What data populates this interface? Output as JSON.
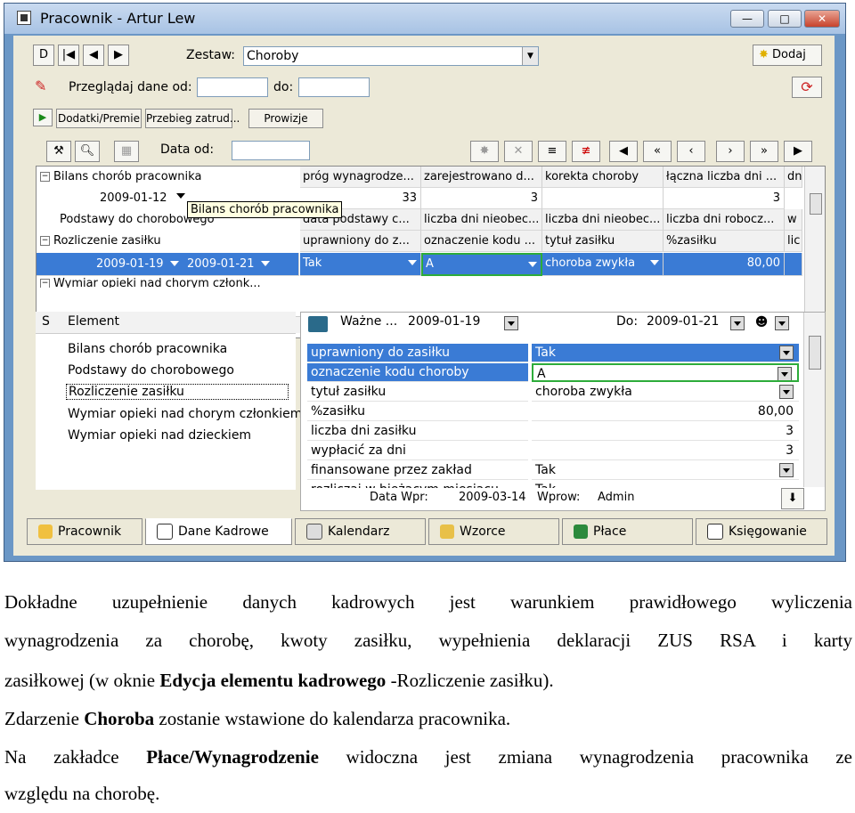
{
  "window": {
    "title": "Pracownik - Artur Lew",
    "min_label": "—",
    "max_label": "□",
    "close_label": "✕"
  },
  "toolbar1": {
    "nav": [
      "D",
      "|◀",
      "◀",
      "▶"
    ],
    "zestaw_label": "Zestaw:",
    "zestaw_value": "Choroby",
    "add_label": "Dodaj"
  },
  "toolbar2": {
    "przegladaj_label": "Przeglądaj dane od:",
    "do_label": "do:",
    "od_value": "",
    "do_value": ""
  },
  "toolbar3": {
    "buttons": [
      "Dodatki/Premie",
      "Przebieg zatrud...",
      "Prowizje"
    ]
  },
  "grid_toolbar": {
    "data_od_label": "Data od:",
    "data_od_value": ""
  },
  "tree": {
    "n1": "Bilans chorób pracownika",
    "n1_date": "2009-01-12",
    "n2": "Podstawy do chorobowego",
    "n3": "Rozliczenie zasiłku",
    "n3_date1": "2009-01-19",
    "n3_date2": "2009-01-21",
    "n4": "Wymiar opieki nad chorym członk..."
  },
  "tooltip": "Bilans chorób pracownika",
  "grid": {
    "row1_headers": [
      "próg wynagrodze...",
      "zarejestrowano d...",
      "korekta choroby",
      "łączna liczba dni ...",
      "dn"
    ],
    "row2_values": [
      "33",
      "3",
      "",
      "3"
    ],
    "row3_headers": [
      "data podstawy c...",
      "liczba dni nieobec...",
      "liczba dni nieobec...",
      "liczba dni robocz...",
      "w"
    ],
    "row4_headers": [
      "uprawniony do z...",
      "oznaczenie kodu ...",
      "tytuł zasiłku",
      "%zasiłku",
      "lic"
    ],
    "row5_values": [
      "Tak",
      "A",
      "choroba zwykła",
      "80,00"
    ]
  },
  "element_list": {
    "col_s": "S",
    "col_element": "Element",
    "items": [
      "Bilans chorób pracownika",
      "Podstawy do chorobowego",
      "Rozliczenie zasiłku",
      "Wymiar opieki nad chorym członkiem...",
      "Wymiar opieki nad dzieckiem"
    ]
  },
  "details": {
    "wazne_label": "Ważne ...",
    "wazne_value": "2009-01-19",
    "do_label": "Do:",
    "do_value": "2009-01-21",
    "rows": [
      {
        "name": "uprawniony do zasiłku",
        "value": "Tak"
      },
      {
        "name": "oznaczenie kodu choroby",
        "value": "A"
      },
      {
        "name": "tytuł zasiłku",
        "value": "choroba zwykła"
      },
      {
        "name": "%zasiłku",
        "value": "80,00"
      },
      {
        "name": "liczba dni zasiłku",
        "value": "3"
      },
      {
        "name": "wypłacić za dni",
        "value": "3"
      },
      {
        "name": "finansowane przez zakład",
        "value": "Tak"
      },
      {
        "name": "rozliczaj w bieżącym miesiącu",
        "value": "Tak"
      }
    ],
    "data_wpr_label": "Data Wpr:",
    "data_wpr_value": "2009-03-14",
    "wprow_label": "Wprow:",
    "wprow_value": "Admin"
  },
  "tabs": [
    "Pracownik",
    "Dane Kadrowe",
    "Kalendarz",
    "Wzorce",
    "Płace",
    "Księgowanie"
  ],
  "text": {
    "p1a": "Dokładne uzupełnienie danych kadrowych jest warunkiem prawidłowego wyliczenia",
    "p1b": "wynagrodzenia za chorobę, kwoty zasiłku, wypełnienia deklaracji ZUS RSA i karty",
    "p1c_pre": "zasiłkowej (w oknie ",
    "p1c_bold": "Edycja elementu kadrowego",
    "p1c_post": " -Rozliczenie zasiłku).",
    "p2_pre": "Zdarzenie ",
    "p2_bold": "Choroba",
    "p2_post": " zostanie wstawione do kalendarza pracownika.",
    "p3_pre": "Na zakładce ",
    "p3_bold": "Płace/Wynagrodzenie",
    "p3_post": " widoczna jest zmiana wynagrodzenia pracownika ze",
    "p3b": "względu na chorobę."
  },
  "colors": {
    "selection": "#3a7bd5",
    "focus_border": "#2dac3a",
    "window_frame": "#6b97c6",
    "client_bg": "#ece9d8"
  }
}
